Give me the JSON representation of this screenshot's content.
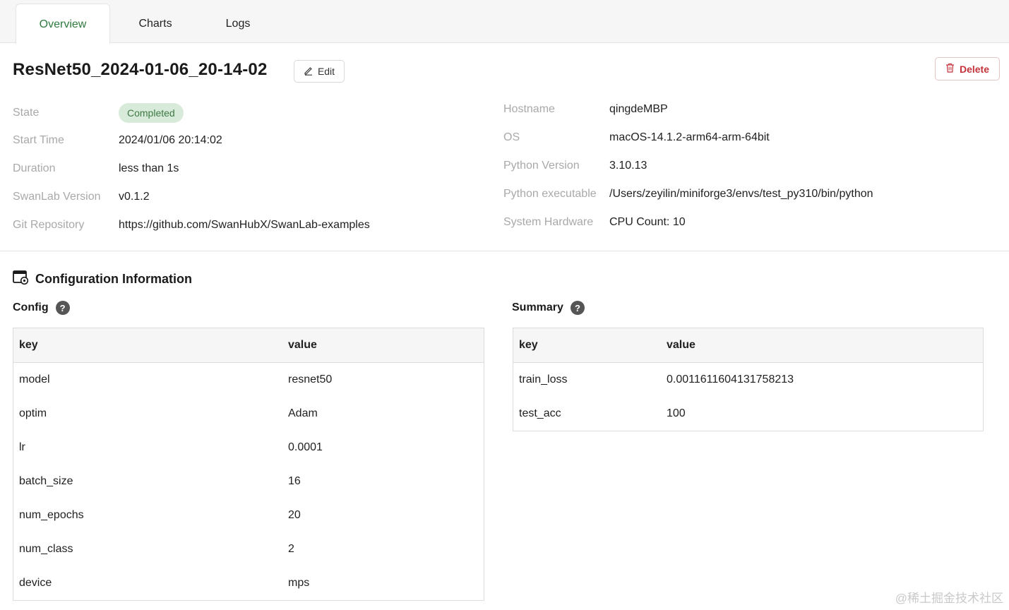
{
  "tabs": [
    {
      "label": "Overview",
      "active": true
    },
    {
      "label": "Charts",
      "active": false
    },
    {
      "label": "Logs",
      "active": false
    }
  ],
  "header": {
    "title": "ResNet50_2024-01-06_20-14-02",
    "edit_label": "Edit",
    "delete_label": "Delete"
  },
  "info_left": [
    {
      "label": "State",
      "value": "Completed"
    },
    {
      "label": "Start Time",
      "value": "2024/01/06 20:14:02"
    },
    {
      "label": "Duration",
      "value": "less than 1s"
    },
    {
      "label": "SwanLab Version",
      "value": "v0.1.2"
    },
    {
      "label": "Git Repository",
      "value": "https://github.com/SwanHubX/SwanLab-examples"
    }
  ],
  "info_right": [
    {
      "label": "Hostname",
      "value": "qingdeMBP"
    },
    {
      "label": "OS",
      "value": "macOS-14.1.2-arm64-arm-64bit"
    },
    {
      "label": "Python Version",
      "value": "3.10.13"
    },
    {
      "label": "Python executable",
      "value": "/Users/zeyilin/miniforge3/envs/test_py310/bin/python"
    },
    {
      "label": "System Hardware",
      "value": "CPU Count: 10"
    }
  ],
  "config_section": {
    "title": "Configuration Information",
    "config_title": "Config",
    "summary_title": "Summary",
    "help_glyph": "?"
  },
  "config_table": {
    "headers": [
      "key",
      "value"
    ],
    "rows": [
      [
        "model",
        "resnet50"
      ],
      [
        "optim",
        "Adam"
      ],
      [
        "lr",
        "0.0001"
      ],
      [
        "batch_size",
        "16"
      ],
      [
        "num_epochs",
        "20"
      ],
      [
        "num_class",
        "2"
      ],
      [
        "device",
        "mps"
      ]
    ]
  },
  "summary_table": {
    "headers": [
      "key",
      "value"
    ],
    "rows": [
      [
        "train_loss",
        "0.0011611604131758213"
      ],
      [
        "test_acc",
        "100"
      ]
    ]
  },
  "watermark": "@稀土掘金技术社区",
  "colors": {
    "accent_green": "#2f7a3e",
    "badge_bg": "#d8ead9",
    "delete_red": "#c4323a"
  }
}
